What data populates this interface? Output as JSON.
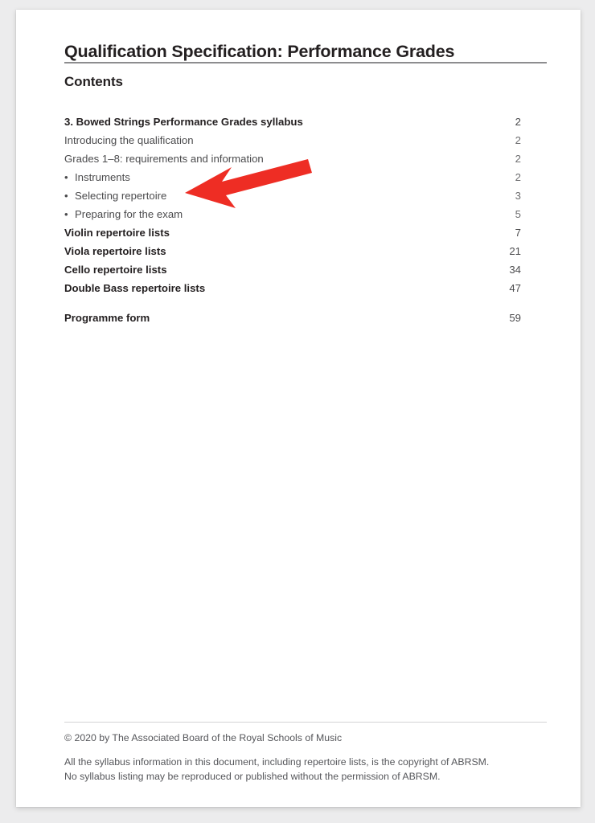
{
  "document": {
    "title": "Qualification Specification: Performance Grades",
    "contents_heading": "Contents"
  },
  "contents": {
    "entries": [
      {
        "label": "3. Bowed Strings Performance Grades syllabus",
        "page": "2",
        "style": "bold",
        "level": 0
      },
      {
        "label": "Introducing the qualification",
        "page": "2",
        "style": "normal",
        "level": 0
      },
      {
        "label": "Grades 1–8: requirements and information",
        "page": "2",
        "style": "normal",
        "level": 0
      },
      {
        "label": "Instruments",
        "page": "2",
        "style": "normal",
        "level": 1
      },
      {
        "label": "Selecting repertoire",
        "page": "3",
        "style": "normal",
        "level": 1
      },
      {
        "label": "Preparing for the exam",
        "page": "5",
        "style": "normal",
        "level": 1
      },
      {
        "label": "Violin repertoire lists",
        "page": "7",
        "style": "bold",
        "level": 0
      },
      {
        "label": "Viola repertoire lists",
        "page": "21",
        "style": "bold",
        "level": 0
      },
      {
        "label": "Cello repertoire lists",
        "page": "34",
        "style": "bold",
        "level": 0
      },
      {
        "label": "Double Bass repertoire lists",
        "page": "47",
        "style": "bold",
        "level": 0
      },
      {
        "label": "Programme form",
        "page": "59",
        "style": "bold",
        "level": 0,
        "gap_before": true
      }
    ],
    "bullet_glyph": "•"
  },
  "footer": {
    "copyright": "© 2020 by The Associated Board of the Royal Schools of Music",
    "note_line_1": "All the syllabus information in this document, including repertoire lists, is the copyright of ABRSM.",
    "note_line_2": "No syllabus listing may be reproduced or published without the permission of ABRSM."
  },
  "annotation": {
    "arrow_color": "#ee2d24",
    "points_to": "Selecting repertoire"
  },
  "colors": {
    "page_background": "#ffffff",
    "canvas_background": "#ececed",
    "text_primary": "#231f20",
    "text_secondary": "#4b4b4d",
    "rule": "#8d8d8f"
  }
}
